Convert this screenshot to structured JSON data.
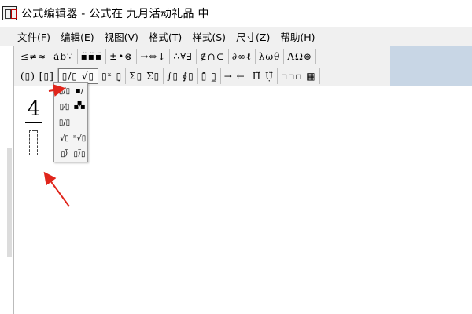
{
  "window": {
    "title": "公式编辑器 - 公式在 九月活动礼品 中",
    "icon": "equation-editor-app-icon"
  },
  "menubar": {
    "items": [
      {
        "label": "文件(F)"
      },
      {
        "label": "编辑(E)"
      },
      {
        "label": "视图(V)"
      },
      {
        "label": "格式(T)"
      },
      {
        "label": "样式(S)"
      },
      {
        "label": "尺寸(Z)"
      },
      {
        "label": "帮助(H)"
      }
    ]
  },
  "toolbar": {
    "row1": [
      {
        "label": "≤≠≈",
        "icon": "relational-symbols-icon"
      },
      {
        "label": "ȧb∵",
        "icon": "spaces-ellipses-icon"
      },
      {
        "label": "▪̈▪̈▪̈",
        "icon": "embellishments-icon"
      },
      {
        "label": "±•⊗",
        "icon": "operator-symbols-icon"
      },
      {
        "label": "→⇔↓",
        "icon": "arrow-symbols-icon"
      },
      {
        "label": "∴∀∃",
        "icon": "logical-symbols-icon"
      },
      {
        "label": "∉∩⊂",
        "icon": "set-theory-symbols-icon"
      },
      {
        "label": "∂∞ℓ",
        "icon": "misc-symbols-icon"
      },
      {
        "label": "λωθ",
        "icon": "greek-lowercase-icon"
      },
      {
        "label": "ΛΩ⊛",
        "icon": "greek-uppercase-icon"
      }
    ],
    "row2": [
      {
        "label": "(▯) [▯]",
        "icon": "fence-templates-icon"
      },
      {
        "label": "▯/▯ √▯",
        "icon": "fraction-radical-templates-icon"
      },
      {
        "label": "▯ˣ ▯̣",
        "icon": "subscript-superscript-templates-icon"
      },
      {
        "label": "Σ▯ Σ▯",
        "icon": "summation-templates-icon"
      },
      {
        "label": "∫▯ ∮▯",
        "icon": "integral-templates-icon"
      },
      {
        "label": "▯̄ ▯̲",
        "icon": "underbar-overbar-templates-icon"
      },
      {
        "label": "→ ←",
        "icon": "labeled-arrow-templates-icon"
      },
      {
        "label": "Π̈ Ụ̈",
        "icon": "products-set-theory-templates-icon"
      },
      {
        "label": "▫▫▫ ▦",
        "icon": "matrix-templates-icon"
      }
    ]
  },
  "editor": {
    "numerator": "4"
  },
  "dropdown": {
    "items": [
      {
        "label": "▯/▯",
        "icon": "full-size-fraction-icon"
      },
      {
        "label": "▪/▪",
        "icon": "reduced-size-fraction-icon"
      },
      {
        "label": "▯⁄▯",
        "icon": "slash-fraction-icon"
      },
      {
        "label": "▪⁄▪",
        "icon": "small-slash-fraction-icon"
      },
      {
        "label": "▯/▯",
        "icon": "horizontal-slash-fraction-icon"
      },
      {
        "label": "√▯",
        "icon": "square-root-icon"
      },
      {
        "label": "ⁿ√▯",
        "icon": "nth-root-icon"
      },
      {
        "label": "▯⟌",
        "icon": "long-division-icon"
      },
      {
        "label": "▯⟌▯",
        "icon": "long-division-with-quotient-icon"
      }
    ]
  },
  "annotations": {
    "color": "#e0251b"
  }
}
